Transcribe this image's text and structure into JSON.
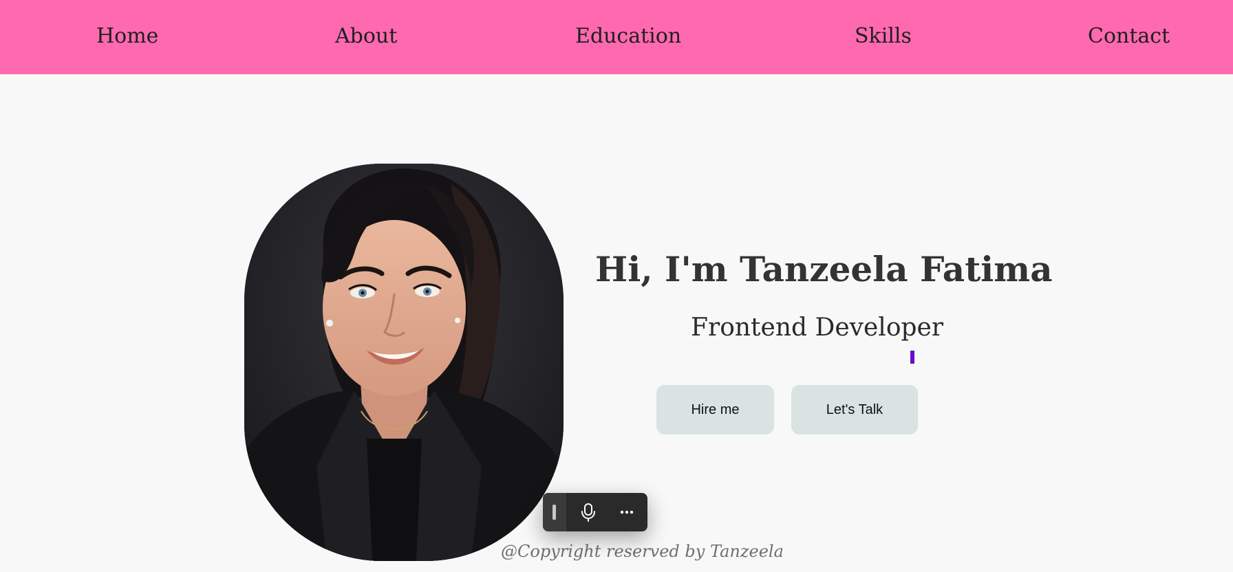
{
  "nav": {
    "home": "Home",
    "about": "About",
    "education": "Education",
    "skills": "Skills",
    "contact": "Contact"
  },
  "hero": {
    "title": "Hi, I'm Tanzeela Fatima",
    "role": "Frontend Developer",
    "hire_button": "Hire me",
    "talk_button": "Let's Talk"
  },
  "footer": {
    "copyright": "@Copyright reserved by Tanzeela"
  },
  "icons": {
    "drag_handle": "drag-handle-icon",
    "microphone": "microphone-icon",
    "more": "more-horizontal-icon"
  },
  "colors": {
    "nav_background": "#ff69b0",
    "page_background": "#f8f8f8",
    "button_background": "#d8e3e2",
    "cursor_accent": "#6a0dcb",
    "text_dark": "#333333"
  }
}
